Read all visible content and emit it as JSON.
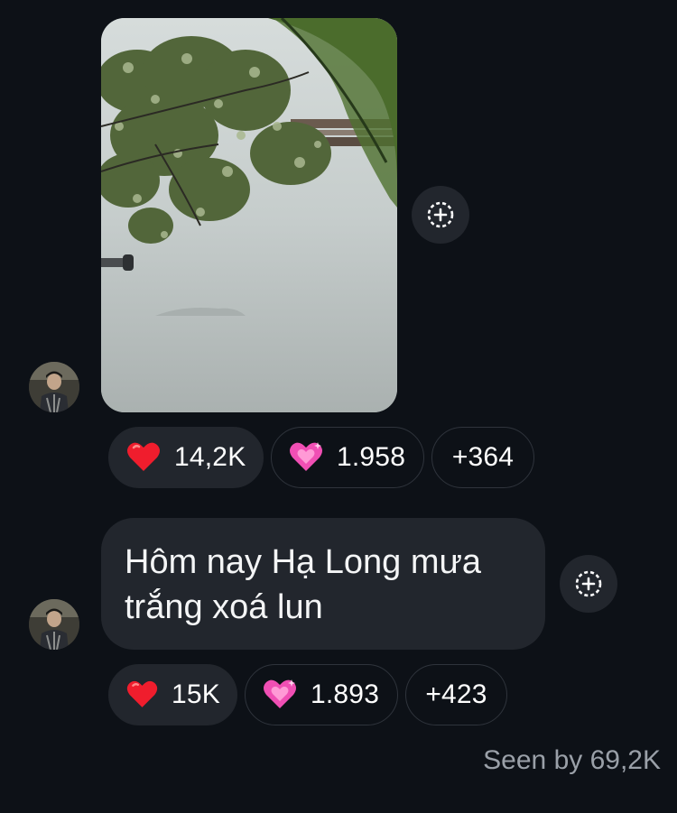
{
  "thread": {
    "messages": [
      {
        "kind": "photo",
        "icon": "share-plus-icon",
        "reactions": [
          {
            "emoji": "red-heart",
            "count": "14,2K"
          },
          {
            "emoji": "sparkling-heart",
            "count": "1.958"
          },
          {
            "extra": "+364"
          }
        ]
      },
      {
        "kind": "text",
        "text_line1": "Hôm nay Hạ Long mưa",
        "text_line2": "trắng xoá lun",
        "icon": "share-plus-icon",
        "reactions": [
          {
            "emoji": "red-heart",
            "count": "15K"
          },
          {
            "emoji": "sparkling-heart",
            "count": "1.893"
          },
          {
            "extra": "+423"
          }
        ]
      }
    ],
    "seen_by": "Seen by 69,2K"
  },
  "colors": {
    "background": "#0d1117",
    "bubble": "#22262d",
    "seen_text": "#9aa0a8"
  }
}
